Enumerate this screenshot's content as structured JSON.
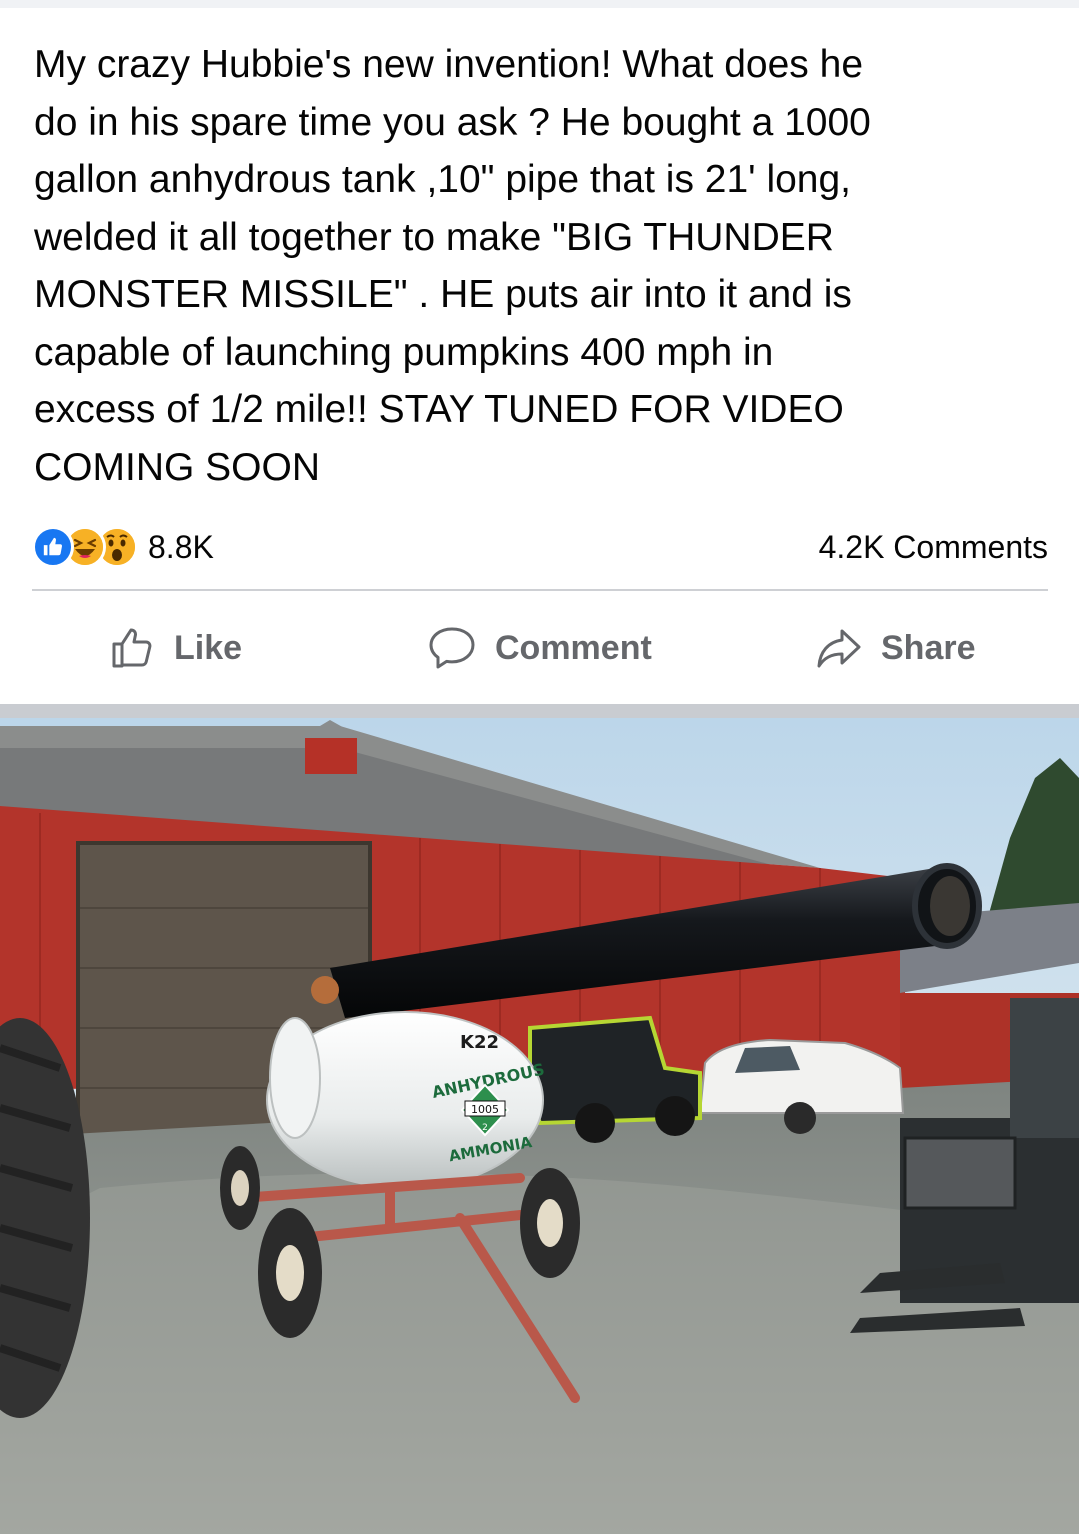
{
  "post": {
    "text": "My crazy Hubbie's new invention!  What does he\ndo in his spare time you ask ?  He bought  a 1000\ngallon anhydrous tank ,10\" pipe that is 21' long,\nwelded it all together to make \"BIG THUNDER\nMONSTER MISSILE\" . HE puts air into it and is\ncapable of launching pumpkins 400 mph in\nexcess of 1/2 mile!! STAY TUNED FOR VIDEO\nCOMING SOON"
  },
  "stats": {
    "reactions": [
      "like-icon",
      "haha-icon",
      "wow-icon"
    ],
    "reaction_count": "8.8K",
    "comments_count": "4.2K Comments"
  },
  "actions": {
    "like_label": "Like",
    "comment_label": "Comment",
    "share_label": "Share"
  },
  "photo": {
    "tank_text_1": "K22",
    "tank_text_2": "ANHYDROUS",
    "tank_text_3": "1005",
    "tank_text_4": "2",
    "tank_text_5": "AMMONIA"
  },
  "colors": {
    "text": "#050505",
    "secondary": "#65676b",
    "like_blue": "#1877f2",
    "emoji_yellow": "#f7b125",
    "divider": "#ced0d4"
  }
}
